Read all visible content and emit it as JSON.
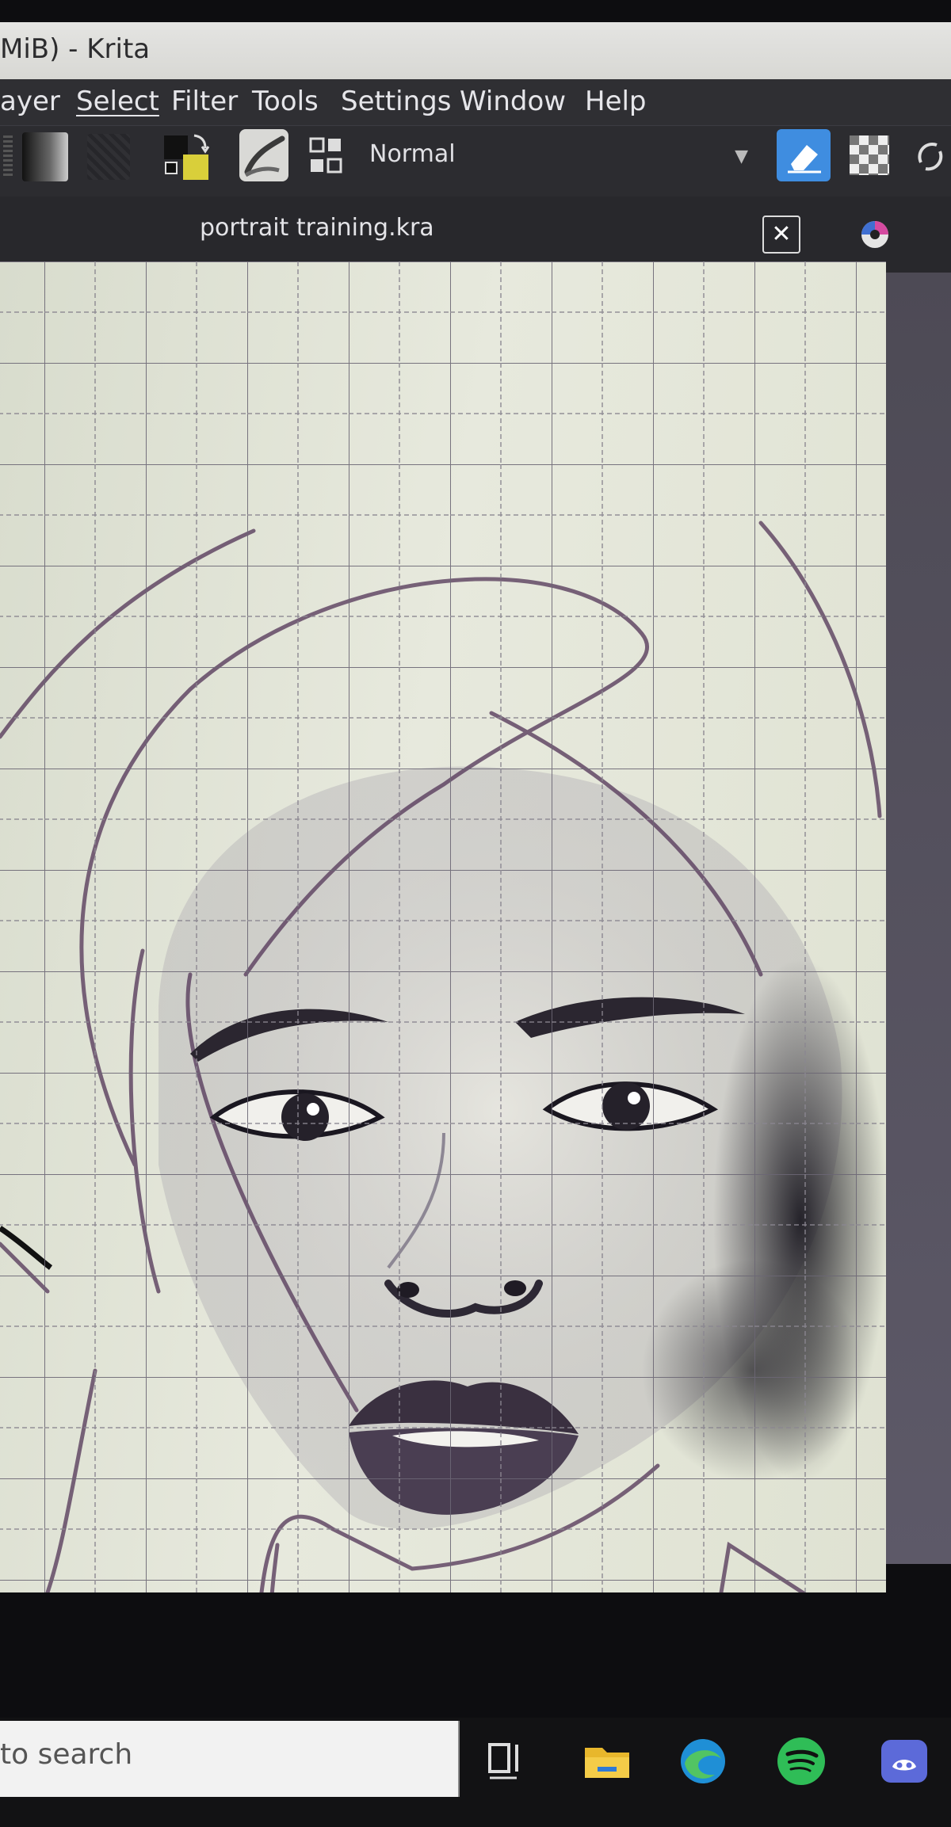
{
  "window": {
    "title": "MiB)  - Krita"
  },
  "menu": {
    "items": [
      {
        "label": "Layer",
        "display": "ayer"
      },
      {
        "label": "Select"
      },
      {
        "label": "Filter"
      },
      {
        "label": "Tools"
      },
      {
        "label": "Settings"
      },
      {
        "label": "Window"
      },
      {
        "label": "Help"
      }
    ]
  },
  "toolbar": {
    "blend_mode": "Normal",
    "icons": [
      "gradient-icon",
      "pattern-icon",
      "color-swap-icon",
      "brush-preset-icon",
      "presets-grid-icon",
      "eraser-mode-icon",
      "alpha-lock-icon",
      "reload-icon"
    ],
    "active_color": "#3f8de0"
  },
  "document": {
    "tab_title": "portrait training.kra",
    "close_label": "✕"
  },
  "taskbar": {
    "search_placeholder": "to search",
    "icons": [
      "task-view-icon",
      "file-explorer-icon",
      "edge-icon",
      "spotify-icon",
      "discord-icon"
    ]
  }
}
